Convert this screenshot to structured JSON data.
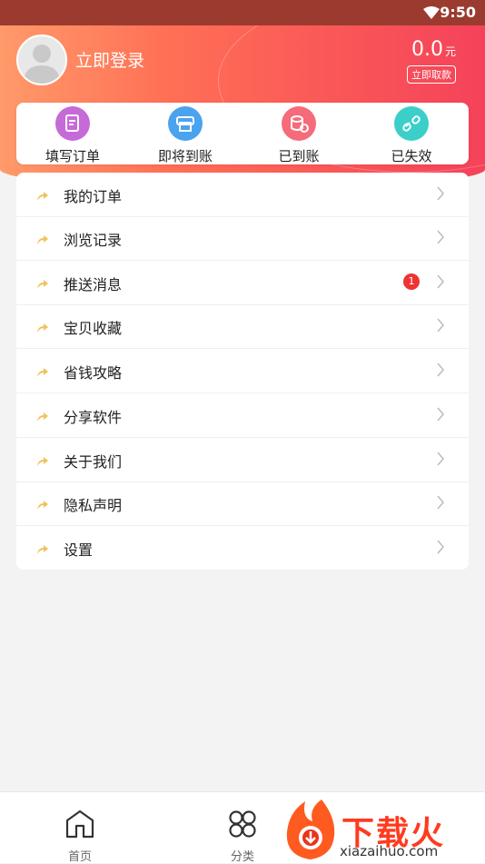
{
  "status_bar": {
    "time": "9:50"
  },
  "header": {
    "login_label": "立即登录",
    "balance_value": "0.0",
    "balance_unit": "元",
    "withdraw_label": "立即取款"
  },
  "orders": [
    {
      "label": "填写订单",
      "icon": "edit-document-icon",
      "color": "#c66ad8"
    },
    {
      "label": "即将到账",
      "icon": "printer-icon",
      "color": "#4aa3ee"
    },
    {
      "label": "已到账",
      "icon": "coins-icon",
      "color": "#f56b7a"
    },
    {
      "label": "已失效",
      "icon": "broken-link-icon",
      "color": "#3ccfc9"
    }
  ],
  "menu": [
    {
      "label": "我的订单"
    },
    {
      "label": "浏览记录"
    },
    {
      "label": "推送消息",
      "badge": "1"
    },
    {
      "label": "宝贝收藏"
    },
    {
      "label": "省钱攻略"
    },
    {
      "label": "分享软件"
    },
    {
      "label": "关于我们"
    },
    {
      "label": "隐私声明"
    },
    {
      "label": "设置"
    }
  ],
  "bottom_nav": [
    {
      "label": "首页",
      "icon": "home-icon"
    },
    {
      "label": "分类",
      "icon": "category-icon"
    }
  ],
  "watermark": {
    "brand": "下载火",
    "url": "xiazaihuo.com"
  },
  "colors": {
    "header_gradient_start": "#ff9a6a",
    "header_gradient_end": "#f5425a",
    "menu_arrow": "#f2c15a",
    "badge": "#e33333"
  }
}
